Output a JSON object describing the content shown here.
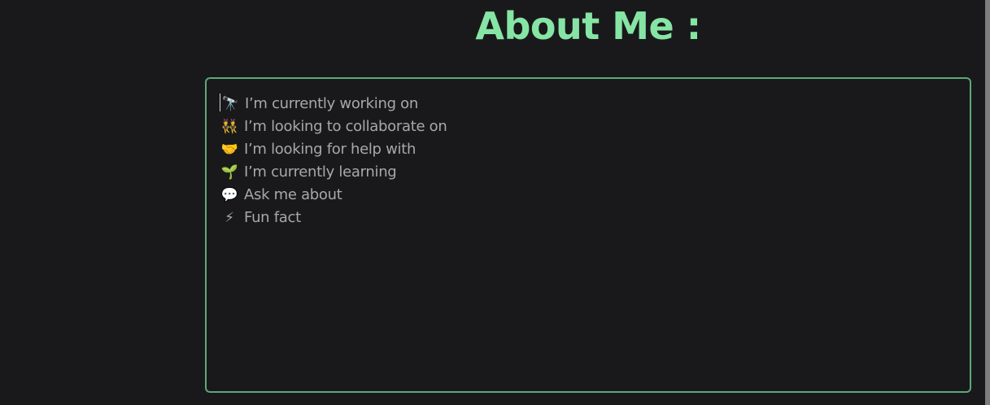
{
  "colors": {
    "background": "#19191b",
    "accent": "#86e5a4",
    "border": "#5ea77a",
    "text": "#a8a8ab"
  },
  "header": {
    "title": "About Me :"
  },
  "about_editor": {
    "lines": [
      {
        "emoji": "🔭",
        "icon": "telescope-icon",
        "text": "I’m currently working on"
      },
      {
        "emoji": "👯",
        "icon": "people-icon",
        "text": "I’m looking to collaborate on"
      },
      {
        "emoji": "🤝",
        "icon": "handshake-icon",
        "text": "I’m looking for help with"
      },
      {
        "emoji": "🌱",
        "icon": "seedling-icon",
        "text": "I’m currently learning"
      },
      {
        "emoji": "💬",
        "icon": "speech-bubble-icon",
        "text": "Ask me about"
      },
      {
        "emoji": "⚡",
        "icon": "lightning-icon",
        "text": "Fun fact"
      }
    ]
  }
}
